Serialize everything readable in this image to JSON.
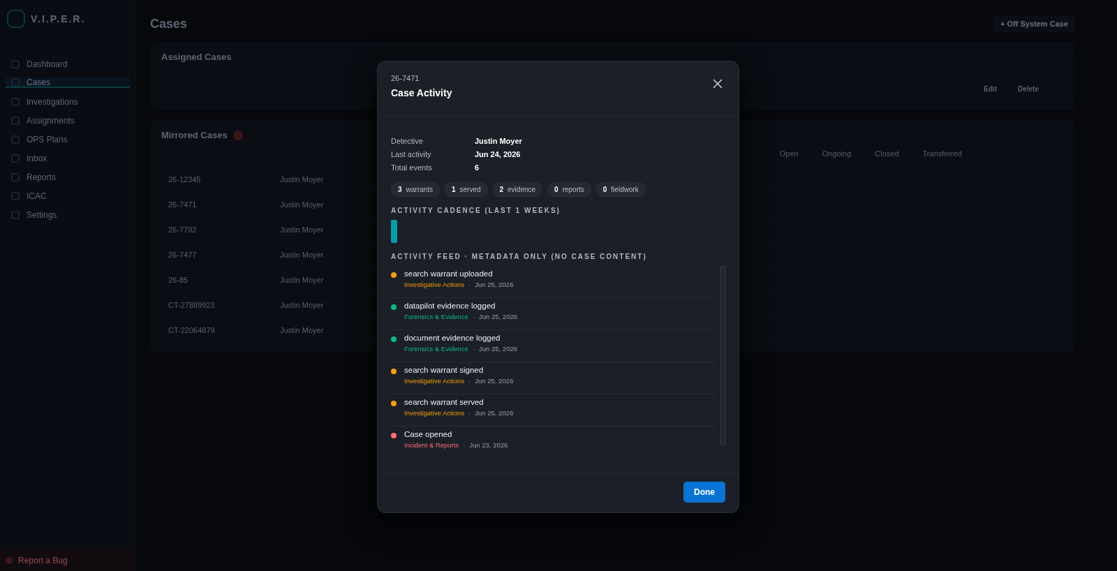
{
  "sidebar": {
    "logo": "V.I.P.E.R.",
    "items": [
      {
        "label": "Dashboard",
        "selected": false
      },
      {
        "label": "Cases",
        "selected": true
      },
      {
        "label": "Investigations",
        "selected": false
      },
      {
        "label": "Assignments",
        "selected": false
      },
      {
        "label": "OPS Plans",
        "selected": false
      },
      {
        "label": "Inbox",
        "selected": false
      },
      {
        "label": "Reports",
        "selected": false
      },
      {
        "label": "ICAC",
        "selected": false
      },
      {
        "label": "Settings",
        "selected": false
      }
    ],
    "bug_button": "Report a Bug"
  },
  "page": {
    "title": "Cases",
    "action": "+ Off System Case"
  },
  "assigned_cases": {
    "title": "Assigned Cases",
    "buttons": [
      "Edit",
      "Delete"
    ]
  },
  "mirrored_cases": {
    "title": "Mirrored Cases",
    "filters": [
      "Open",
      "Ongoing",
      "Closed",
      "Transferred"
    ],
    "rows": [
      {
        "case": "26-12345",
        "detective": "Justin Moyer"
      },
      {
        "case": "26-7471",
        "detective": "Justin Moyer"
      },
      {
        "case": "26-7792",
        "detective": "Justin Moyer"
      },
      {
        "case": "26-7477",
        "detective": "Justin Moyer"
      },
      {
        "case": "26-85",
        "detective": "Justin Moyer"
      },
      {
        "case": "CT-27889923",
        "detective": "Justin Moyer"
      },
      {
        "case": "CT-22064879",
        "detective": "Justin Moyer"
      }
    ]
  },
  "modal": {
    "case_number": "26-7471",
    "title": "Case Activity",
    "details": [
      {
        "label": "Detective",
        "value": "Justin Moyer"
      },
      {
        "label": "Last activity",
        "value": "Jun 24, 2026"
      },
      {
        "label": "Total events",
        "value": "6"
      }
    ],
    "counts": [
      {
        "count": "3",
        "label": "warrants"
      },
      {
        "count": "1",
        "label": "served"
      },
      {
        "count": "2",
        "label": "evidence"
      },
      {
        "count": "0",
        "label": "reports"
      },
      {
        "count": "0",
        "label": "fieldwork"
      }
    ],
    "cadence": {
      "title": "ACTIVITY CADENCE (LAST 1 WEEKS)",
      "bars": [
        {
          "level": 1
        }
      ]
    },
    "feed": {
      "title": "ACTIVITY FEED · METADATA ONLY (NO CASE CONTENT)",
      "items": [
        {
          "title": "search warrant uploaded",
          "category": "Investigative Actions",
          "separator": "·",
          "date": "Jun 25, 2026",
          "color": "#f59e0b"
        },
        {
          "title": "datapilot evidence logged",
          "category": "Forensics & Evidence",
          "separator": "·",
          "date": "Jun 25, 2026",
          "color": "#10b981"
        },
        {
          "title": "document evidence logged",
          "category": "Forensics & Evidence",
          "separator": "·",
          "date": "Jun 25, 2026",
          "color": "#10b981"
        },
        {
          "title": "search warrant signed",
          "category": "Investigative Actions",
          "separator": "·",
          "date": "Jun 25, 2026",
          "color": "#f59e0b"
        },
        {
          "title": "search warrant served",
          "category": "Investigative Actions",
          "separator": "·",
          "date": "Jun 25, 2026",
          "color": "#f59e0b"
        },
        {
          "title": "Case opened",
          "category": "Incident & Reports",
          "separator": "·",
          "date": "Jun 23, 2026",
          "color": "#f87171"
        }
      ]
    },
    "done_button": "Done"
  }
}
